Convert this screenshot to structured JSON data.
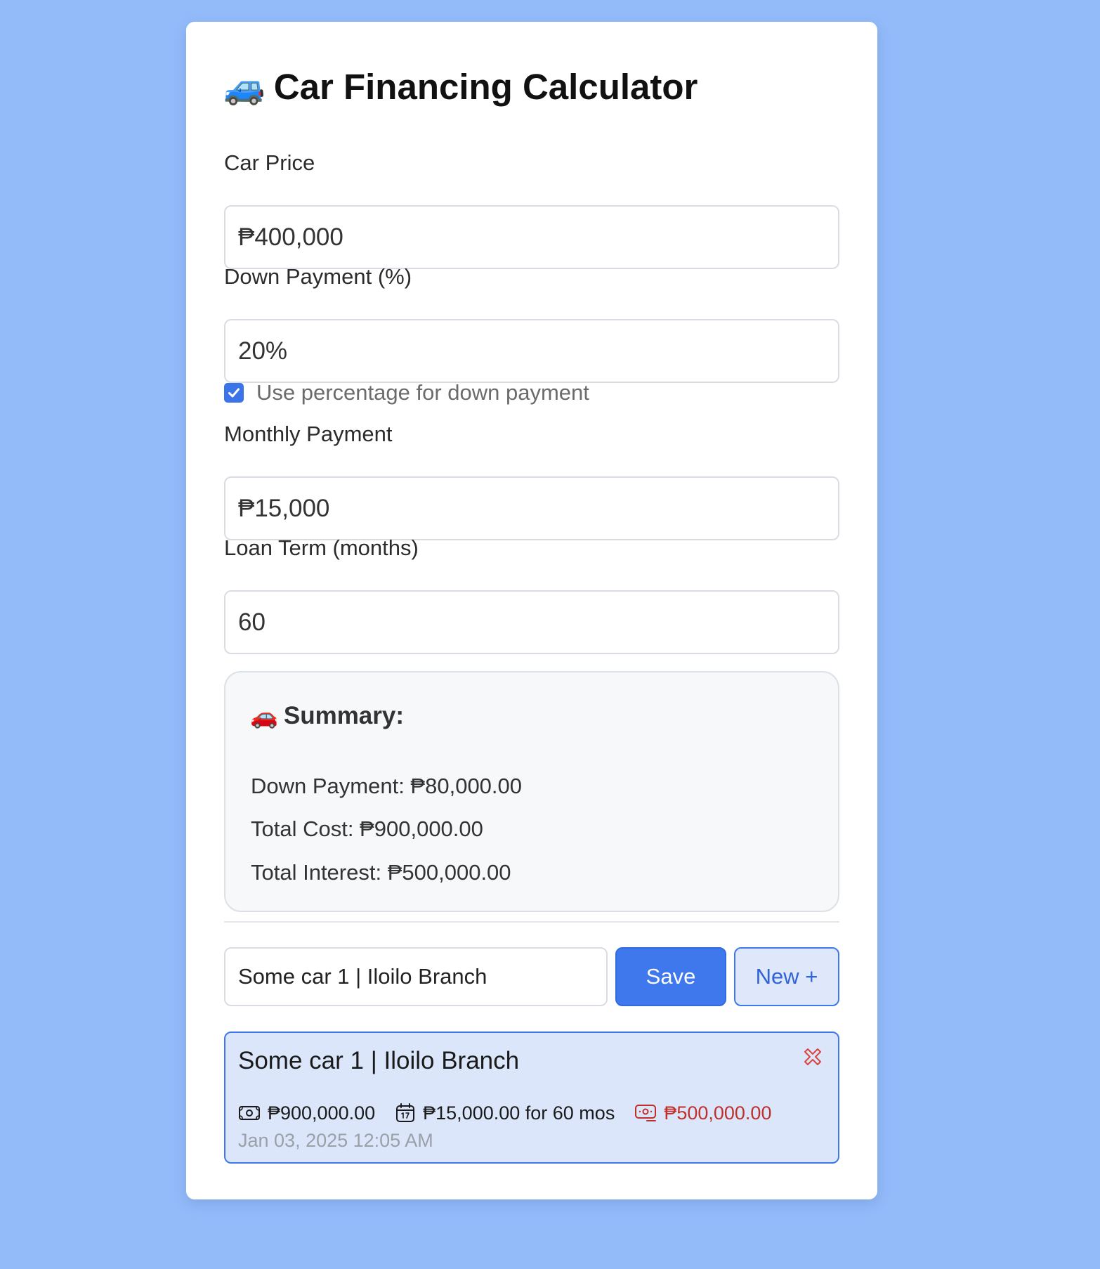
{
  "app": {
    "title": "Car Financing Calculator",
    "title_emoji": "🚙"
  },
  "form": {
    "car_price": {
      "label": "Car Price",
      "value": "₱400,000"
    },
    "down_payment": {
      "label": "Down Payment (%)",
      "value": "20%"
    },
    "use_percentage": {
      "label": "Use percentage for down payment",
      "checked": true
    },
    "monthly_payment": {
      "label": "Monthly Payment",
      "value": "₱15,000"
    },
    "loan_term": {
      "label": "Loan Term (months)",
      "value": "60"
    }
  },
  "summary": {
    "emoji": "🚗",
    "title": "Summary:",
    "down_payment": "Down Payment: ₱80,000.00",
    "total_cost": "Total Cost: ₱900,000.00",
    "total_interest": "Total Interest: ₱500,000.00"
  },
  "save_bar": {
    "name_value": "Some car 1 | Iloilo Branch",
    "save_label": "Save",
    "new_label": "New +"
  },
  "saved_items": [
    {
      "title": "Some car 1 | Iloilo Branch",
      "total_cost": "₱900,000.00",
      "monthly": "₱15,000.00 for 60 mos",
      "interest": "₱500,000.00",
      "date": "Jan 03, 2025 12:05 AM",
      "icons": [
        "cash-icon",
        "calendar-icon",
        "interest-cash-icon",
        "delete-x-icon"
      ]
    }
  ],
  "colors": {
    "background": "#93bbfa",
    "accent": "#3f77ec",
    "interest_red": "#c0302b",
    "saved_item_bg": "#dbe6fb"
  }
}
